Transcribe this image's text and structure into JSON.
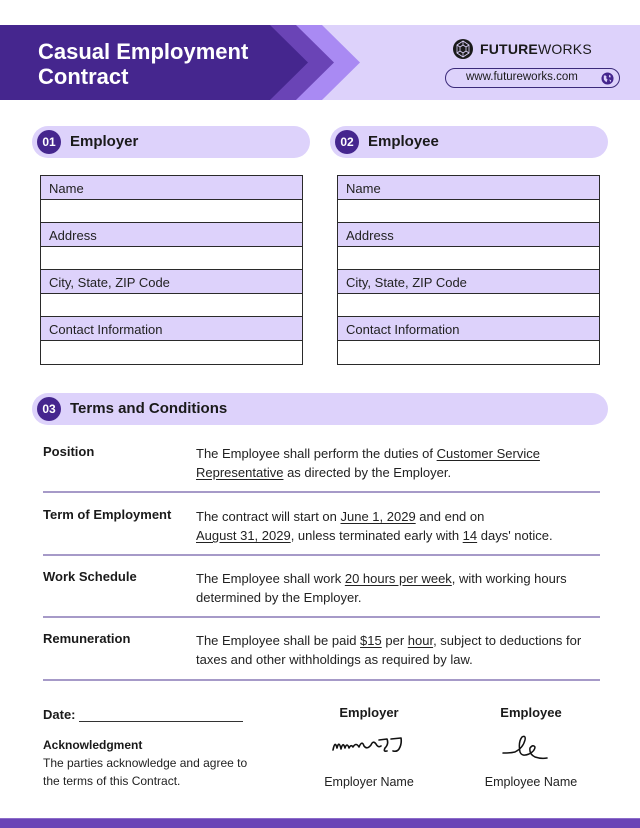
{
  "header": {
    "title_line1": "Casual Employment",
    "title_line2": "Contract",
    "brand_bold": "FUTURE",
    "brand_light": "WORKS",
    "url": "www.futureworks.com",
    "icons": {
      "logo": "geodesic-sphere-icon",
      "website": "globe-icon"
    }
  },
  "colors": {
    "primary_dark": "#45268e",
    "chevron_mid": "#6a44b6",
    "chevron_light": "#a98af3",
    "pill_bg": "#ddd2fb",
    "rule": "#a69ac8",
    "bottom_bar": "#6a44b6"
  },
  "sections": {
    "employer": {
      "number": "01",
      "title": "Employer",
      "fields": [
        "Name",
        "Address",
        "City, State, ZIP Code",
        "Contact Information"
      ]
    },
    "employee": {
      "number": "02",
      "title": "Employee",
      "fields": [
        "Name",
        "Address",
        "City, State, ZIP Code",
        "Contact Information"
      ]
    },
    "terms": {
      "number": "03",
      "title": "Terms and Conditions",
      "items": [
        {
          "label": "Position",
          "parts": [
            "The Employee shall perform the duties of ",
            "Customer Service Representative",
            " as directed by the Employer."
          ]
        },
        {
          "label": "Term of Employment",
          "parts": [
            "The contract will start on ",
            "June 1, 2029",
            " and end on ",
            "August 31, 2029",
            ", unless terminated early with ",
            "14",
            " days' notice."
          ]
        },
        {
          "label": "Work Schedule",
          "parts": [
            "The Employee shall work ",
            "20 hours per week",
            ", with working hours determined by the Employer."
          ]
        },
        {
          "label": "Remuneration",
          "parts": [
            "The Employee shall be paid ",
            "$15",
            " per ",
            "hour",
            ", subject to deductions for taxes and other withholdings as required by law."
          ]
        }
      ]
    }
  },
  "footer": {
    "date_label": "Date:",
    "ack_title": "Acknowledgment",
    "ack_text": "The parties acknowledge and agree to the terms of this Contract.",
    "employer_heading": "Employer",
    "employer_name": "Employer Name",
    "employee_heading": "Employee",
    "employee_name": "Employee Name"
  }
}
